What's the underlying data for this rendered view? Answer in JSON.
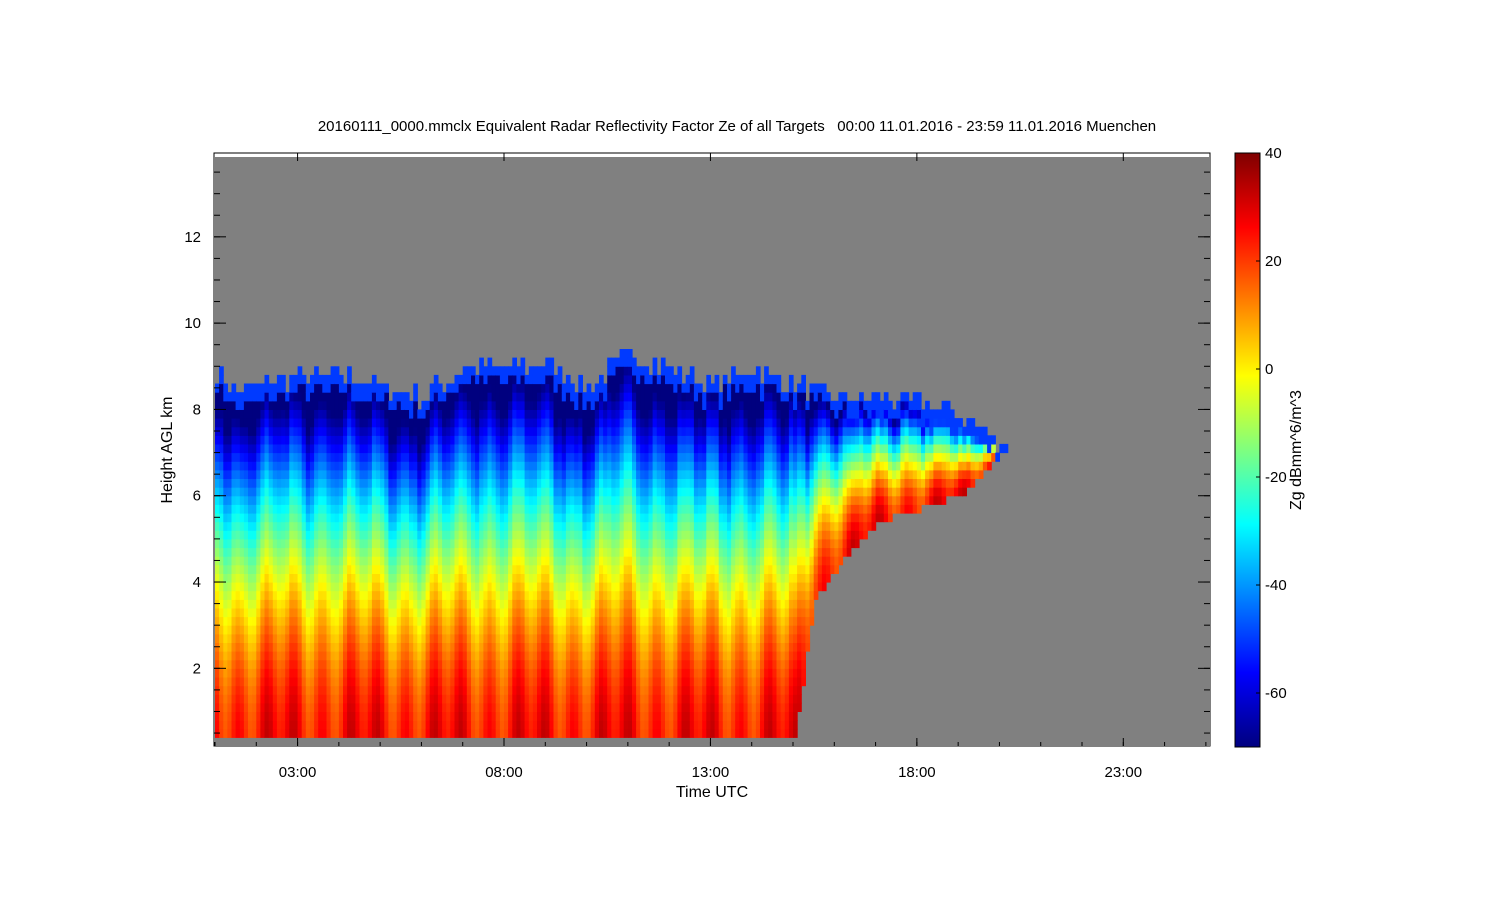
{
  "chart_data": {
    "type": "heatmap",
    "title": "20160111_0000.mmclx Equivalent Radar Reflectivity Factor Ze of all Targets   00:00 11.01.2016 - 23:59 11.01.2016 Muenchen",
    "xlabel": "Time UTC",
    "ylabel": "Height AGL km",
    "x_units": "hours UTC",
    "xlim": [
      1.0,
      25.1
    ],
    "ylim": [
      0.2,
      13.85
    ],
    "x_ticks": [
      {
        "value": 3,
        "label": "03:00"
      },
      {
        "value": 8,
        "label": "08:00"
      },
      {
        "value": 13,
        "label": "13:00"
      },
      {
        "value": 18,
        "label": "18:00"
      },
      {
        "value": 23,
        "label": "23:00"
      }
    ],
    "y_ticks": [
      {
        "value": 2,
        "label": "2"
      },
      {
        "value": 4,
        "label": "4"
      },
      {
        "value": 6,
        "label": "6"
      },
      {
        "value": 8,
        "label": "8"
      },
      {
        "value": 10,
        "label": "10"
      },
      {
        "value": 12,
        "label": "12"
      }
    ],
    "colorbar": {
      "label": "Zg dBmm^6/m^3",
      "range": [
        -70,
        40
      ],
      "ticks": [
        {
          "value": 40,
          "label": "40"
        },
        {
          "value": 20,
          "label": "20"
        },
        {
          "value": 0,
          "label": "0"
        },
        {
          "value": -20,
          "label": "-20"
        },
        {
          "value": -40,
          "label": "-40"
        },
        {
          "value": -60,
          "label": "-60"
        }
      ],
      "colors": [
        "#00007f",
        "#0000ff",
        "#007fff",
        "#00ffff",
        "#7fff7f",
        "#ffff00",
        "#ff7f00",
        "#ff0000",
        "#7f0000"
      ]
    },
    "no_signal_color": "#808080",
    "echo_top_km": [
      {
        "t": 1.0,
        "top": 8.8
      },
      {
        "t": 1.5,
        "top": 8.3
      },
      {
        "t": 2.5,
        "top": 8.6
      },
      {
        "t": 4.0,
        "top": 8.7
      },
      {
        "t": 5.5,
        "top": 8.3
      },
      {
        "t": 6.0,
        "top": 8.2
      },
      {
        "t": 7.0,
        "top": 8.9
      },
      {
        "t": 9.0,
        "top": 8.9
      },
      {
        "t": 10.0,
        "top": 8.4
      },
      {
        "t": 11.0,
        "top": 9.2
      },
      {
        "t": 12.0,
        "top": 8.8
      },
      {
        "t": 13.0,
        "top": 8.5
      },
      {
        "t": 14.0,
        "top": 8.8
      },
      {
        "t": 16.0,
        "top": 8.2
      },
      {
        "t": 18.0,
        "top": 8.1
      },
      {
        "t": 19.0,
        "top": 7.8
      },
      {
        "t": 20.2,
        "top": 7.0
      }
    ],
    "echo_base_km": [
      {
        "t": 1.0,
        "base": 0.3
      },
      {
        "t": 15.0,
        "base": 0.3
      },
      {
        "t": 15.5,
        "base": 3.5
      },
      {
        "t": 16.0,
        "base": 4.2
      },
      {
        "t": 17.0,
        "base": 5.3
      },
      {
        "t": 18.0,
        "base": 5.6
      },
      {
        "t": 19.0,
        "base": 5.9
      },
      {
        "t": 20.2,
        "base": 7.0
      }
    ],
    "max_reflectivity_dbz": 25,
    "min_reflectivity_dbz": -65
  }
}
